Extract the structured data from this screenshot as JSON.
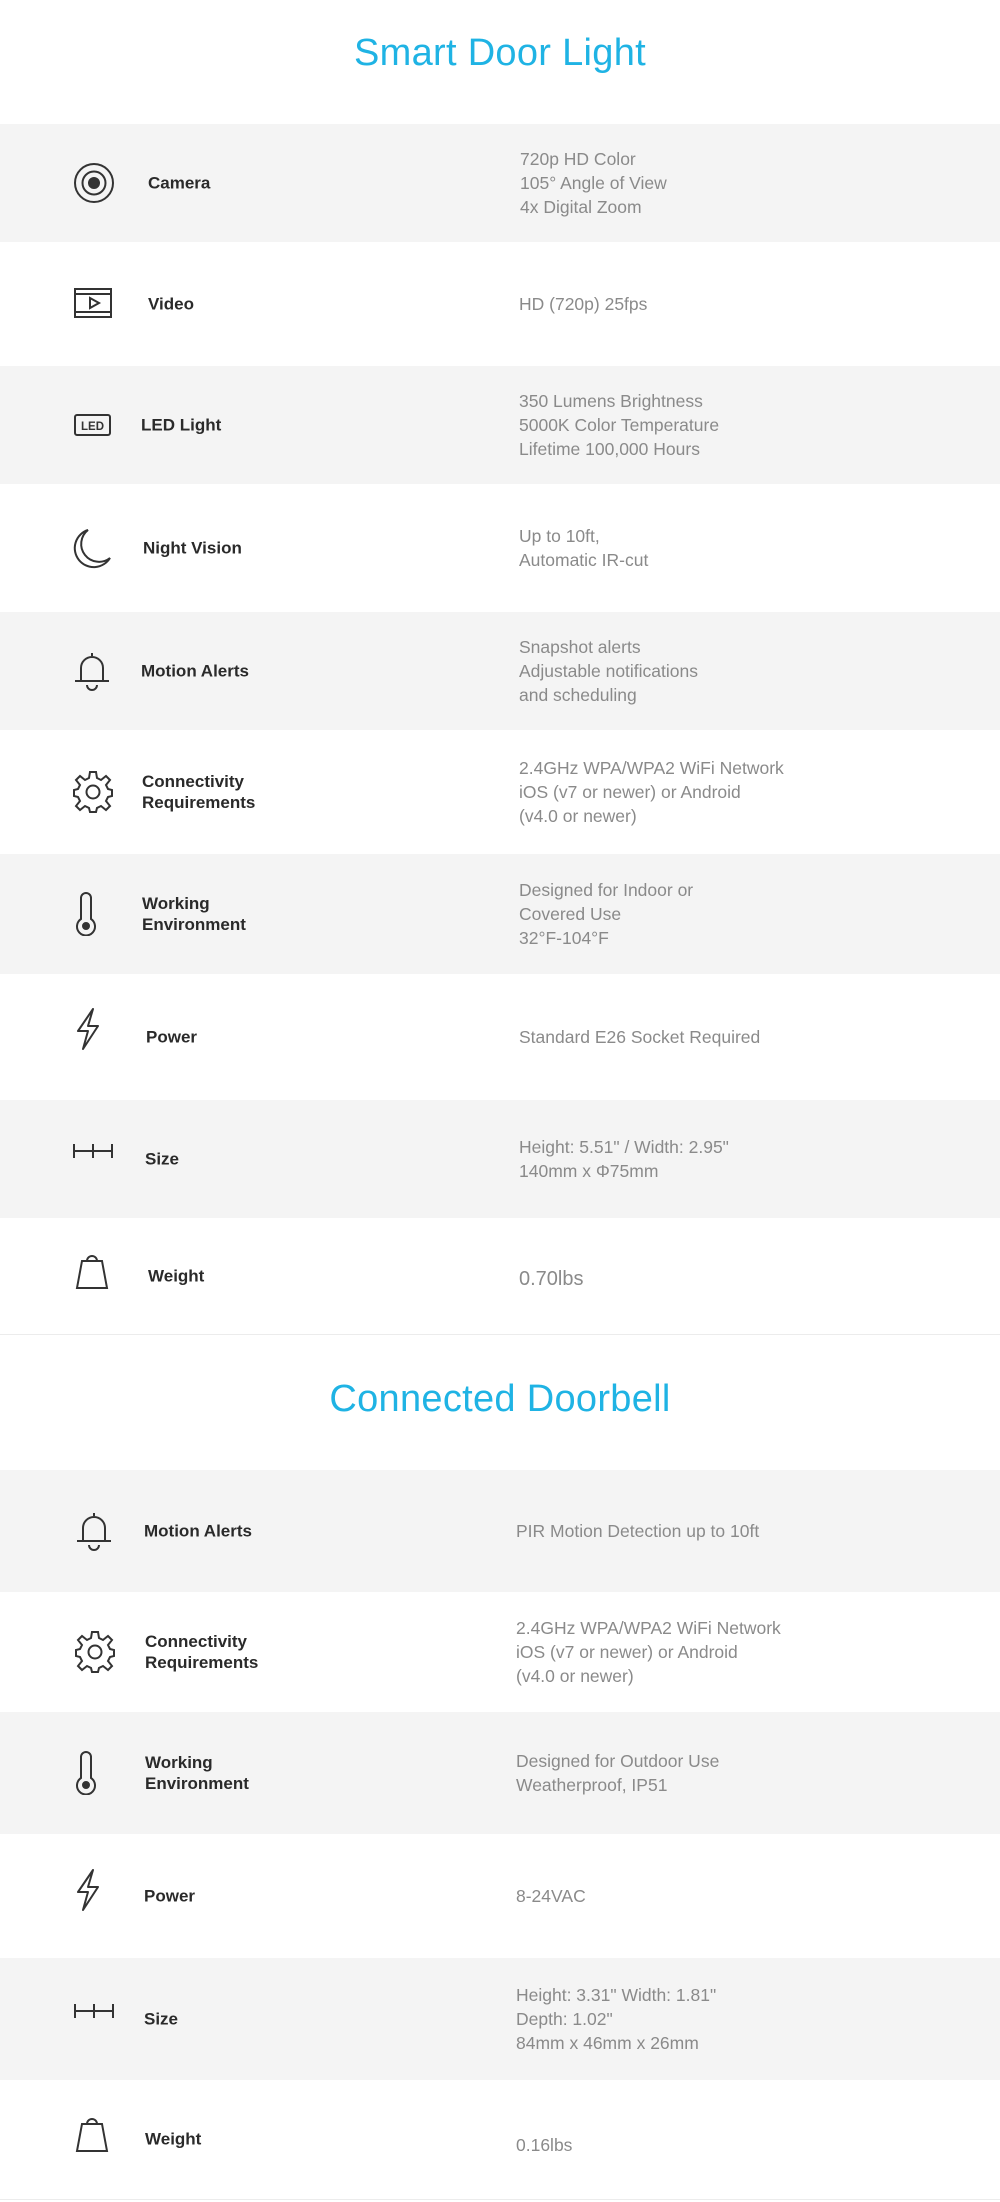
{
  "sections": [
    {
      "title": "Smart Door Light",
      "rows": [
        {
          "icon": "camera-icon",
          "label": "Camera",
          "value": "720p HD Color\n105° Angle of View\n4x Digital Zoom"
        },
        {
          "icon": "video-icon",
          "label": "Video",
          "value": "HD (720p) 25fps"
        },
        {
          "icon": "led-icon",
          "label": "LED Light",
          "value": "350 Lumens Brightness\n5000K Color Temperature\nLifetime 100,000 Hours"
        },
        {
          "icon": "moon-icon",
          "label": "Night Vision",
          "value": "Up to 10ft,\nAutomatic IR-cut"
        },
        {
          "icon": "bell-icon",
          "label": "Motion Alerts",
          "value": "Snapshot alerts\nAdjustable notifications\nand scheduling"
        },
        {
          "icon": "gear-icon",
          "label": "Connectivity\nRequirements",
          "value": "2.4GHz WPA/WPA2 WiFi Network\niOS (v7 or newer) or Android\n(v4.0 or newer)"
        },
        {
          "icon": "thermometer-icon",
          "label": "Working\nEnvironment",
          "value": "Designed for Indoor or\nCovered Use\n32°F-104°F"
        },
        {
          "icon": "lightning-icon",
          "label": "Power",
          "value": "Standard E26 Socket Required"
        },
        {
          "icon": "ruler-icon",
          "label": "Size",
          "value": "Height: 5.51\" / Width: 2.95\"\n140mm x Φ75mm"
        },
        {
          "icon": "weight-icon",
          "label": "Weight",
          "value": "0.70lbs"
        }
      ]
    },
    {
      "title": "Connected Doorbell",
      "rows": [
        {
          "icon": "bell-icon",
          "label": "Motion Alerts",
          "value": "PIR Motion Detection up to 10ft"
        },
        {
          "icon": "gear-icon",
          "label": "Connectivity\nRequirements",
          "value": "2.4GHz WPA/WPA2 WiFi Network\niOS (v7 or newer) or Android\n (v4.0 or newer)"
        },
        {
          "icon": "thermometer-icon",
          "label": "Working\nEnvironment",
          "value": "Designed for Outdoor Use\nWeatherproof, IP51"
        },
        {
          "icon": "lightning-icon",
          "label": "Power",
          "value": "8-24VAC"
        },
        {
          "icon": "ruler-icon",
          "label": "Size",
          "value": "Height: 3.31\"  Width: 1.81\"\nDepth: 1.02\"\n84mm x 46mm x 26mm"
        },
        {
          "icon": "weight-icon",
          "label": "Weight",
          "value": "0.16lbs"
        }
      ]
    }
  ],
  "colors": {
    "title": "#1fb3e4",
    "shaded_row": "#f4f4f4",
    "label": "#2a2a2a",
    "value": "#8a8a8a"
  }
}
